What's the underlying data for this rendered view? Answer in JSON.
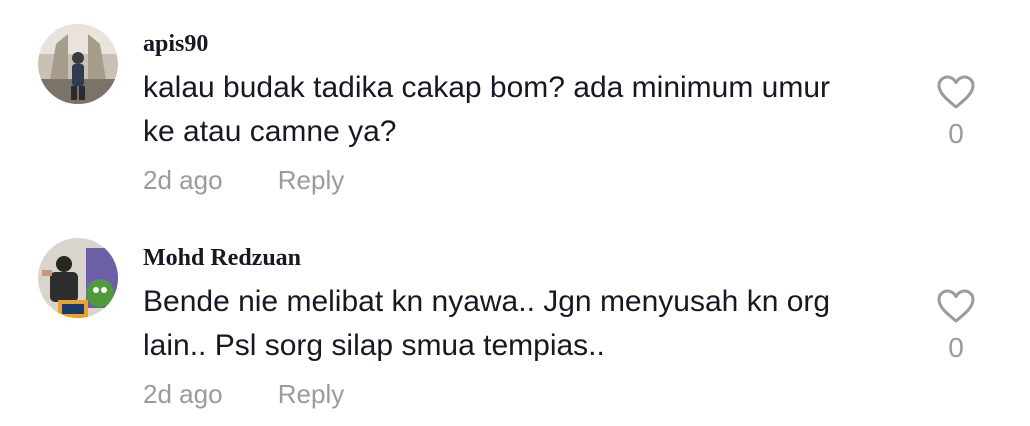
{
  "comments": [
    {
      "username": "apis90",
      "text_lines": [
        "kalau budak tadika cakap bom? ada minimum umur",
        "ke atau camne ya?"
      ],
      "time": "2d ago",
      "reply_label": "Reply",
      "like_count": "0"
    },
    {
      "username": "Mohd Redzuan",
      "text_lines": [
        "Bende nie melibat kn nyawa.. Jgn menyusah kn org",
        "lain.. Psl sorg silap smua tempias.."
      ],
      "time": "2d ago",
      "reply_label": "Reply",
      "like_count": "0"
    }
  ],
  "icons": {
    "like": "heart-outline-icon"
  },
  "colors": {
    "primary_text": "#161823",
    "secondary_text": "#9a9aa0"
  }
}
